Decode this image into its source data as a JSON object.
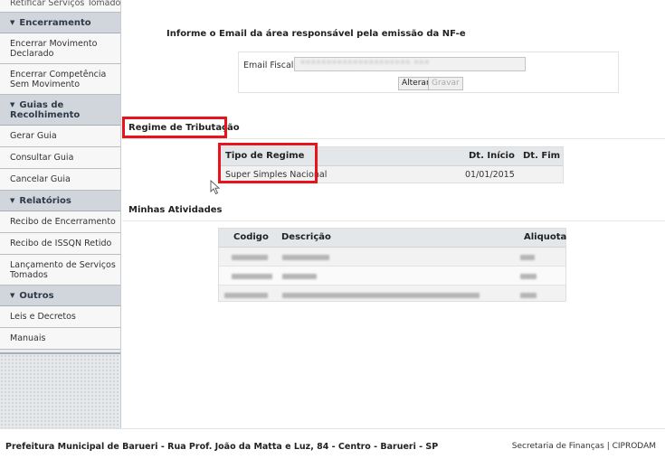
{
  "sidebar": {
    "items": [
      {
        "type": "link",
        "label": "Retificar Serviços Tomados",
        "partial": true
      },
      {
        "type": "header",
        "label": "Encerramento"
      },
      {
        "type": "link",
        "label": "Encerrar Movimento Declarado",
        "two_line": true
      },
      {
        "type": "link",
        "label": "Encerrar Competência Sem Movimento",
        "two_line": true
      },
      {
        "type": "header",
        "label": "Guias de Recolhimento",
        "two_line": true
      },
      {
        "type": "link",
        "label": "Gerar Guia"
      },
      {
        "type": "link",
        "label": "Consultar Guia"
      },
      {
        "type": "link",
        "label": "Cancelar Guia"
      },
      {
        "type": "header",
        "label": "Relatórios"
      },
      {
        "type": "link",
        "label": "Recibo de Encerramento"
      },
      {
        "type": "link",
        "label": "Recibo de ISSQN Retido"
      },
      {
        "type": "link",
        "label": "Lançamento de Serviços Tomados",
        "two_line": true
      },
      {
        "type": "header",
        "label": "Outros"
      },
      {
        "type": "link",
        "label": "Leis e Decretos"
      },
      {
        "type": "link",
        "label": "Manuais"
      }
    ]
  },
  "email_section": {
    "title": "Informe o Email da área responsável pela emissão da NF-e",
    "label": "Email Fiscal:",
    "value": "•••••••••••••••••••••  •••",
    "alterar_label": "Alterar",
    "gravar_label": "Gravar"
  },
  "regime": {
    "title": "Regime de Tributação",
    "headers": {
      "tipo": "Tipo de Regime",
      "inicio": "Dt. Início",
      "fim": "Dt. Fim"
    },
    "rows": [
      {
        "tipo": "Super Simples Nacional",
        "inicio": "01/01/2015",
        "fim": ""
      }
    ]
  },
  "atividades": {
    "title": "Minhas Atividades",
    "headers": {
      "codigo": "Codigo",
      "descricao": "Descrição",
      "aliquota": "Aliquota"
    }
  },
  "footer": {
    "left": "Prefeitura Municipal de Barueri - Rua Prof. João da Matta e Luz, 84 - Centro - Barueri - SP",
    "right": "Secretaria de Finanças | CIPRODAM"
  },
  "icons": {
    "chevron": "chevron-down-icon",
    "cursor": "mouse-cursor-icon"
  },
  "colors": {
    "highlight": "#e8141b",
    "sidebar_header": "#d0d6dc",
    "table_header": "#e4e7ea"
  }
}
